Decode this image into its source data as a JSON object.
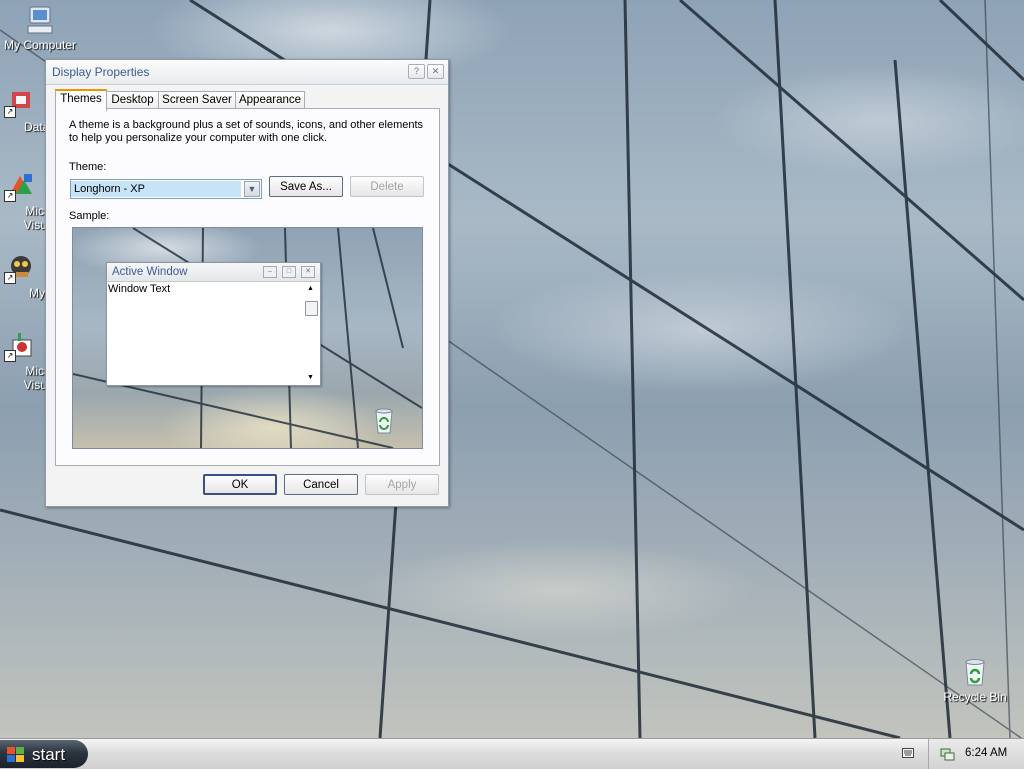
{
  "desktop": {
    "icons": [
      {
        "label": "My Computer",
        "icon": "computer-icon"
      },
      {
        "label": "DataWa",
        "icon": "shortcut-app-icon"
      },
      {
        "label": "Micro",
        "label2": "Visual",
        "icon": "visual-studio-icon"
      },
      {
        "label": "My",
        "icon": "pictures-icon"
      },
      {
        "label": "Micro",
        "label2": "Visual",
        "icon": "visual-studio-2-icon"
      },
      {
        "label": "Recycle Bin",
        "icon": "recycle-bin-icon"
      }
    ]
  },
  "dialog": {
    "title": "Display Properties",
    "tabs": [
      "Themes",
      "Desktop",
      "Screen Saver",
      "Appearance"
    ],
    "active_tab": "Themes",
    "description": "A theme is a background plus a set of sounds, icons, and other elements to help you personalize your computer with one click.",
    "theme_label": "Theme:",
    "theme_value": "Longhorn - XP",
    "save_as": "Save As...",
    "delete": "Delete",
    "sample_label": "Sample:",
    "sample": {
      "window_title": "Active Window",
      "window_text": "Window Text"
    },
    "ok": "OK",
    "cancel": "Cancel",
    "apply": "Apply"
  },
  "taskbar": {
    "start_label": "start",
    "clock": "6:24 AM"
  },
  "colors": {
    "title_text": "#3c5a94",
    "selection": "#c7e3f8",
    "tab_highlight": "#e59700"
  }
}
